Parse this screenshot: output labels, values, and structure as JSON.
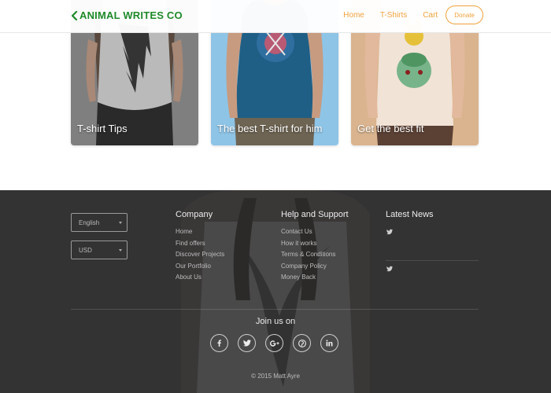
{
  "header": {
    "brand": "ANIMAL WRITES CO",
    "brand_color": "#1e8a2a",
    "accent_color": "#f0a23c",
    "nav": [
      "Home",
      "T-Shirts",
      "Cart"
    ],
    "donate": "Donate"
  },
  "cards": [
    {
      "title": "T-shirt Tips",
      "bg": "#8e8e8e"
    },
    {
      "title": "The best T-shirt for him",
      "bg": "#8ec4e6"
    },
    {
      "title": "Get the best fit",
      "bg": "#d9b48e"
    }
  ],
  "footer": {
    "language": "English",
    "currency": "USD",
    "company": {
      "title": "Company",
      "links": [
        "Home",
        "Find offers",
        "Discover Projects",
        "Our Portfolio",
        "About Us"
      ]
    },
    "help": {
      "title": "Help and Support",
      "links": [
        "Contact Us",
        "How it works",
        "Terms & Conditions",
        "Company Policy",
        "Money Back"
      ]
    },
    "news": {
      "title": "Latest News",
      "items": [
        "twitter-icon",
        "twitter-icon"
      ]
    },
    "join": "Join us on",
    "socials": [
      "facebook-icon",
      "twitter-icon",
      "google-plus-icon",
      "pinterest-icon",
      "linkedin-icon"
    ],
    "copyright": "© 2015 Matt Ayre"
  }
}
